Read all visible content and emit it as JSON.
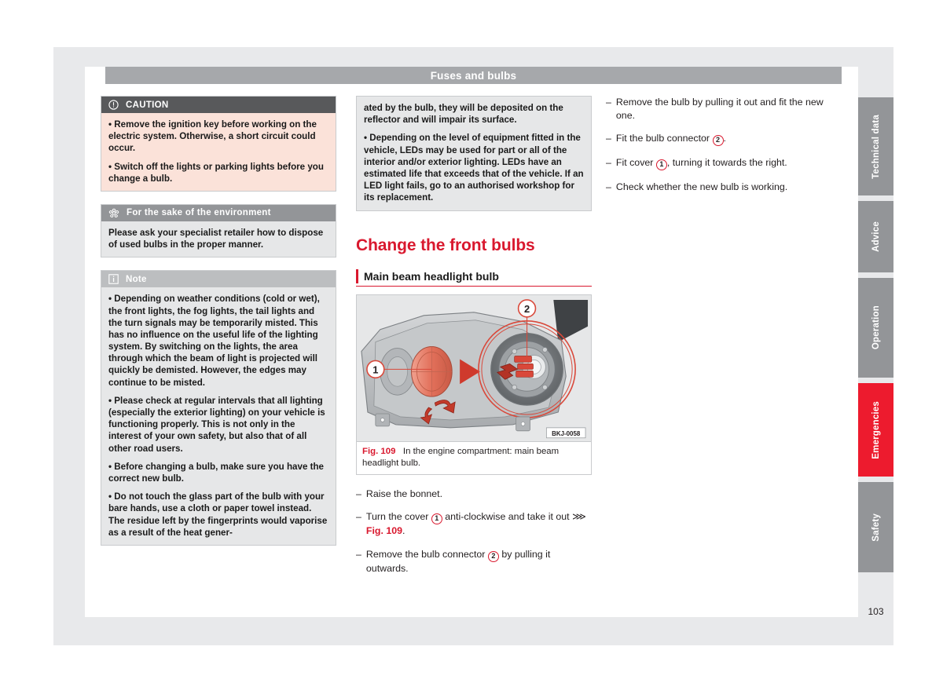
{
  "header": {
    "title": "Fuses and bulbs"
  },
  "left_column": {
    "caution": {
      "icon": "exclamation-circle-icon",
      "title": "CAUTION",
      "paragraphs": [
        "• Remove the ignition key before working on the electric system. Otherwise, a short circuit could occur.",
        "• Switch off the lights or parking lights before you change a bulb."
      ]
    },
    "environment": {
      "icon": "flower-environment-icon",
      "title": "For the sake of the environment",
      "paragraphs": [
        "Please ask your specialist retailer how to dispose of used bulbs in the proper manner."
      ]
    },
    "note": {
      "icon": "info-square-icon",
      "title": "Note",
      "paragraphs": [
        "• Depending on weather conditions (cold or wet), the front lights, the fog lights, the tail lights and the turn signals may be temporarily misted. This has no influence on the useful life of the lighting system. By switching on the lights, the area through which the beam of light is projected will quickly be demisted. However, the edges may continue to be misted.",
        "• Please check at regular intervals that all lighting (especially the exterior lighting) on your vehicle is functioning properly. This is not only in the interest of your own safety, but also that of all other road users.",
        "• Before changing a bulb, make sure you have the correct new bulb.",
        "• Do not touch the glass part of the bulb with your bare hands, use a cloth or paper towel instead. The residue left by the fingerprints would vaporise as a result of the heat gener-"
      ]
    }
  },
  "middle_column": {
    "continued_note": {
      "paragraphs": [
        "ated by the bulb, they will be deposited on the reflector and will impair its surface.",
        "• Depending on the level of equipment fitted in the vehicle, LEDs may be used for part or all of the interior and/or exterior lighting. LEDs have an estimated life that exceeds that of the vehicle. If an LED light fails, go to an authorised workshop for its replacement."
      ]
    },
    "section_title": "Change the front bulbs",
    "subsection_title": "Main beam headlight bulb",
    "figure": {
      "watermark": "BKJ-0058",
      "callout_1": "1",
      "callout_2": "2",
      "caption_label": "Fig. 109",
      "caption_text": "In the engine compartment: main beam headlight bulb."
    },
    "steps": [
      {
        "dash": "–",
        "before": "Raise the bonnet.",
        "callout": "",
        "after": "",
        "ref": ""
      },
      {
        "dash": "–",
        "before": "Turn the cover ",
        "callout": "1",
        "after": " anti-clockwise and take it out ⋙ ",
        "ref": "Fig. 109",
        "tail": "."
      },
      {
        "dash": "–",
        "before": "Remove the bulb connector ",
        "callout": "2",
        "after": " by pulling it outwards.",
        "ref": "",
        "tail": ""
      }
    ]
  },
  "right_column": {
    "steps": [
      {
        "dash": "–",
        "before": "Remove the bulb by pulling it out and fit the new one.",
        "callout": "",
        "after": ""
      },
      {
        "dash": "–",
        "before": "Fit the bulb connector ",
        "callout": "2",
        "after": "."
      },
      {
        "dash": "–",
        "before": "Fit cover ",
        "callout": "1",
        "after": ", turning it towards the right."
      },
      {
        "dash": "–",
        "before": "Check whether the new bulb is working.",
        "callout": "",
        "after": ""
      }
    ]
  },
  "thumb_tabs": [
    {
      "label": "Technical data",
      "active": false
    },
    {
      "label": "Advice",
      "active": false
    },
    {
      "label": "Operation",
      "active": false
    },
    {
      "label": "Emergencies",
      "active": true
    },
    {
      "label": "Safety",
      "active": false
    }
  ],
  "page_number": "103",
  "colors": {
    "accent_red": "#d9182e",
    "tab_active_red": "#ed1b2e",
    "header_grey": "#a6a8ab",
    "caution_head": "#58595b",
    "caution_body": "#fbe2d9",
    "note_body": "#e6e7e8",
    "page_bg": "#e8e9eb"
  }
}
